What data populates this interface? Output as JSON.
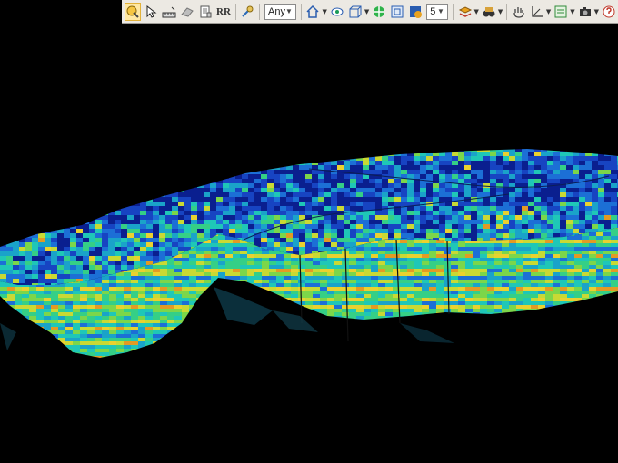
{
  "toolbar": {
    "filter_select": {
      "value": "Any"
    },
    "count_select": {
      "value": "5"
    },
    "buttons": [
      {
        "icon": "select-pick-icon",
        "active": true
      },
      {
        "icon": "cursor-icon"
      },
      {
        "icon": "ruler-icon"
      },
      {
        "icon": "eraser-icon"
      },
      {
        "icon": "document-icon"
      },
      {
        "icon": "rr-text-icon",
        "glyph": "RR"
      },
      {
        "icon": "pick-tool-icon"
      },
      {
        "icon": "home-view-icon"
      },
      {
        "icon": "eye-view-icon"
      },
      {
        "icon": "cube-view-icon"
      },
      {
        "icon": "move-crosshair-icon"
      },
      {
        "icon": "frame-icon"
      },
      {
        "icon": "grid-count-icon"
      },
      {
        "icon": "layers-icon"
      },
      {
        "icon": "binoculars-icon"
      },
      {
        "icon": "hand-pan-icon"
      },
      {
        "icon": "axis-icon"
      },
      {
        "icon": "panel-icon"
      },
      {
        "icon": "camera-icon"
      },
      {
        "icon": "help-icon"
      }
    ]
  },
  "viewport": {
    "background": "#000000",
    "palette": [
      "#0a1f8f",
      "#1744c2",
      "#1c6fd6",
      "#1aa3c9",
      "#1fc7b7",
      "#35cf86",
      "#7cd64a",
      "#c9d934",
      "#ead12f",
      "#e39a24"
    ]
  }
}
